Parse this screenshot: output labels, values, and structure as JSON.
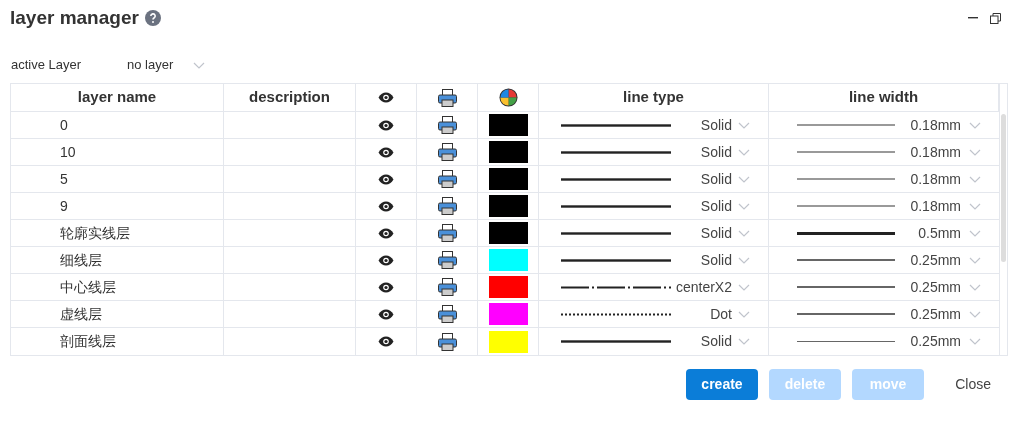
{
  "window": {
    "title": "layer manager"
  },
  "active_layer": {
    "label": "active Layer",
    "value": "no layer"
  },
  "table": {
    "columns": [
      "layer name",
      "description",
      "line type",
      "line width"
    ],
    "rows": [
      {
        "name": "0",
        "visible": true,
        "printable": true,
        "color": "#000000",
        "line_type": "Solid",
        "kind": "solid",
        "line_width": "0.18mm"
      },
      {
        "name": "10",
        "visible": true,
        "printable": true,
        "color": "#000000",
        "line_type": "Solid",
        "kind": "solid",
        "line_width": "0.18mm"
      },
      {
        "name": "5",
        "visible": true,
        "printable": true,
        "color": "#000000",
        "line_type": "Solid",
        "kind": "solid",
        "line_width": "0.18mm"
      },
      {
        "name": "9",
        "visible": true,
        "printable": true,
        "color": "#000000",
        "line_type": "Solid",
        "kind": "solid",
        "line_width": "0.18mm"
      },
      {
        "name": "轮廓实线层",
        "visible": true,
        "printable": true,
        "color": "#000000",
        "line_type": "Solid",
        "kind": "solid",
        "line_width": "0.5mm"
      },
      {
        "name": "细线层",
        "visible": true,
        "printable": true,
        "color": "#00ffff",
        "line_type": "Solid",
        "kind": "solid",
        "line_width": "0.25mm"
      },
      {
        "name": "中心线层",
        "visible": true,
        "printable": true,
        "color": "#ff0000",
        "line_type": "centerX2",
        "kind": "center",
        "line_width": "0.25mm"
      },
      {
        "name": "虚线层",
        "visible": true,
        "printable": true,
        "color": "#ff00ff",
        "line_type": "Dot",
        "kind": "dot",
        "line_width": "0.25mm"
      },
      {
        "name": "剖面线层",
        "visible": true,
        "printable": true,
        "color": "#ffff00",
        "line_type": "Solid",
        "kind": "solid",
        "line_width": "0.25mm"
      }
    ]
  },
  "buttons": [
    {
      "label": "create",
      "kind": "primary",
      "disabled": false
    },
    {
      "label": "delete",
      "kind": "primary",
      "disabled": true
    },
    {
      "label": "move",
      "kind": "primary",
      "disabled": true
    },
    {
      "label": "Close",
      "kind": "plain",
      "disabled": false
    }
  ]
}
